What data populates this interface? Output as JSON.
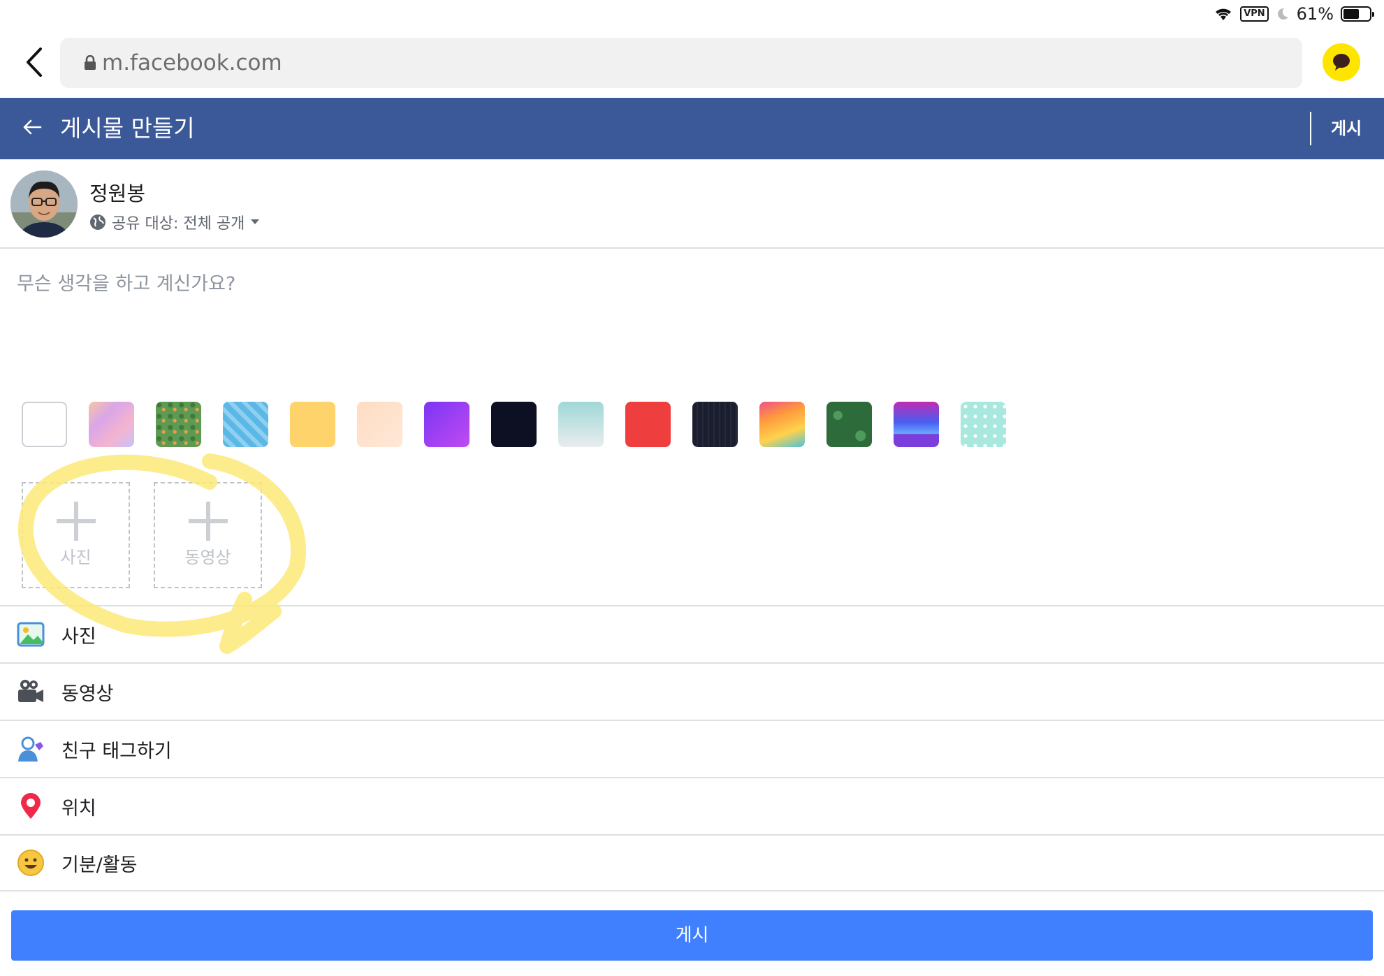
{
  "status_bar": {
    "vpn": "VPN",
    "battery": "61%",
    "battery_level": 0.61
  },
  "browser": {
    "url": "m.facebook.com"
  },
  "header": {
    "title": "게시물 만들기",
    "post_label": "게시"
  },
  "composer": {
    "user_name": "정원봉",
    "audience": "공유 대상: 전체 공개",
    "placeholder": "무슨 생각을 하고 계신가요?"
  },
  "backgrounds": [
    "#ffffff",
    "#e9b8d9",
    "#5f9a54",
    "#5bb8e6",
    "#ffd36b",
    "#ffdcc2",
    "#9f3cf4",
    "#0d1022",
    "#b5e3e0",
    "#ee3e3e",
    "#1b1e2e",
    "#f57a72",
    "#2e6b3a",
    "#7b3ddb",
    "#a8e8de"
  ],
  "media_boxes": {
    "photo": "사진",
    "video": "동영상"
  },
  "options": {
    "photo": "사진",
    "video": "동영상",
    "tag": "친구 태그하기",
    "location": "위치",
    "feeling": "기분/활동"
  },
  "submit_label": "게시",
  "colors": {
    "fb_blue": "#3b5998",
    "button_blue": "#4080ff",
    "annotation": "#fde977"
  }
}
